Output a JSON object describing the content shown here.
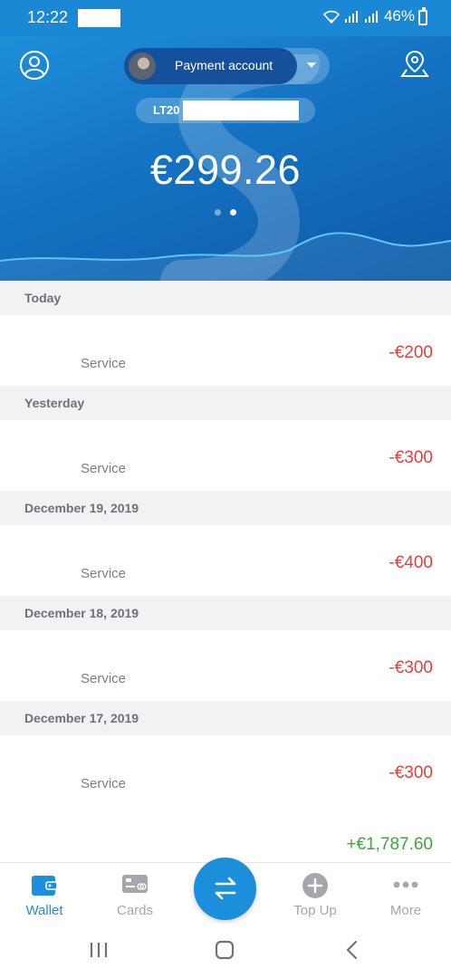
{
  "status_bar": {
    "time": "12:22",
    "battery": "46%"
  },
  "header": {
    "account_label": "Payment account",
    "iban_prefix": "LT20",
    "balance": "€299.26",
    "page_dots": 2,
    "active_dot": 2
  },
  "transactions": [
    {
      "date": "Today",
      "subtitle": "Service",
      "amount": "-€200"
    },
    {
      "date": "Yesterday",
      "subtitle": "Service",
      "amount": "-€300"
    },
    {
      "date": "December 19, 2019",
      "subtitle": "Service",
      "amount": "-€400"
    },
    {
      "date": "December 18, 2019",
      "subtitle": "Service",
      "amount": "-€300"
    },
    {
      "date": "December 17, 2019",
      "subtitle": "Service",
      "amount": "-€300",
      "extra_amount": "+€1,787.60"
    }
  ],
  "bottom_nav": {
    "wallet": "Wallet",
    "cards": "Cards",
    "topup": "Top Up",
    "more": "More"
  },
  "colors": {
    "primary": "#1c8fdc",
    "negative": "#e0413d",
    "positive": "#3aa83a",
    "muted": "#a4a7ab"
  },
  "icons": {
    "profile": "profile-icon",
    "location": "location-pin-icon",
    "transfer": "transfer-arrows-icon",
    "wallet": "wallet-icon",
    "cards": "card-icon",
    "topup": "plus-circle-icon",
    "more": "more-dots-icon"
  }
}
